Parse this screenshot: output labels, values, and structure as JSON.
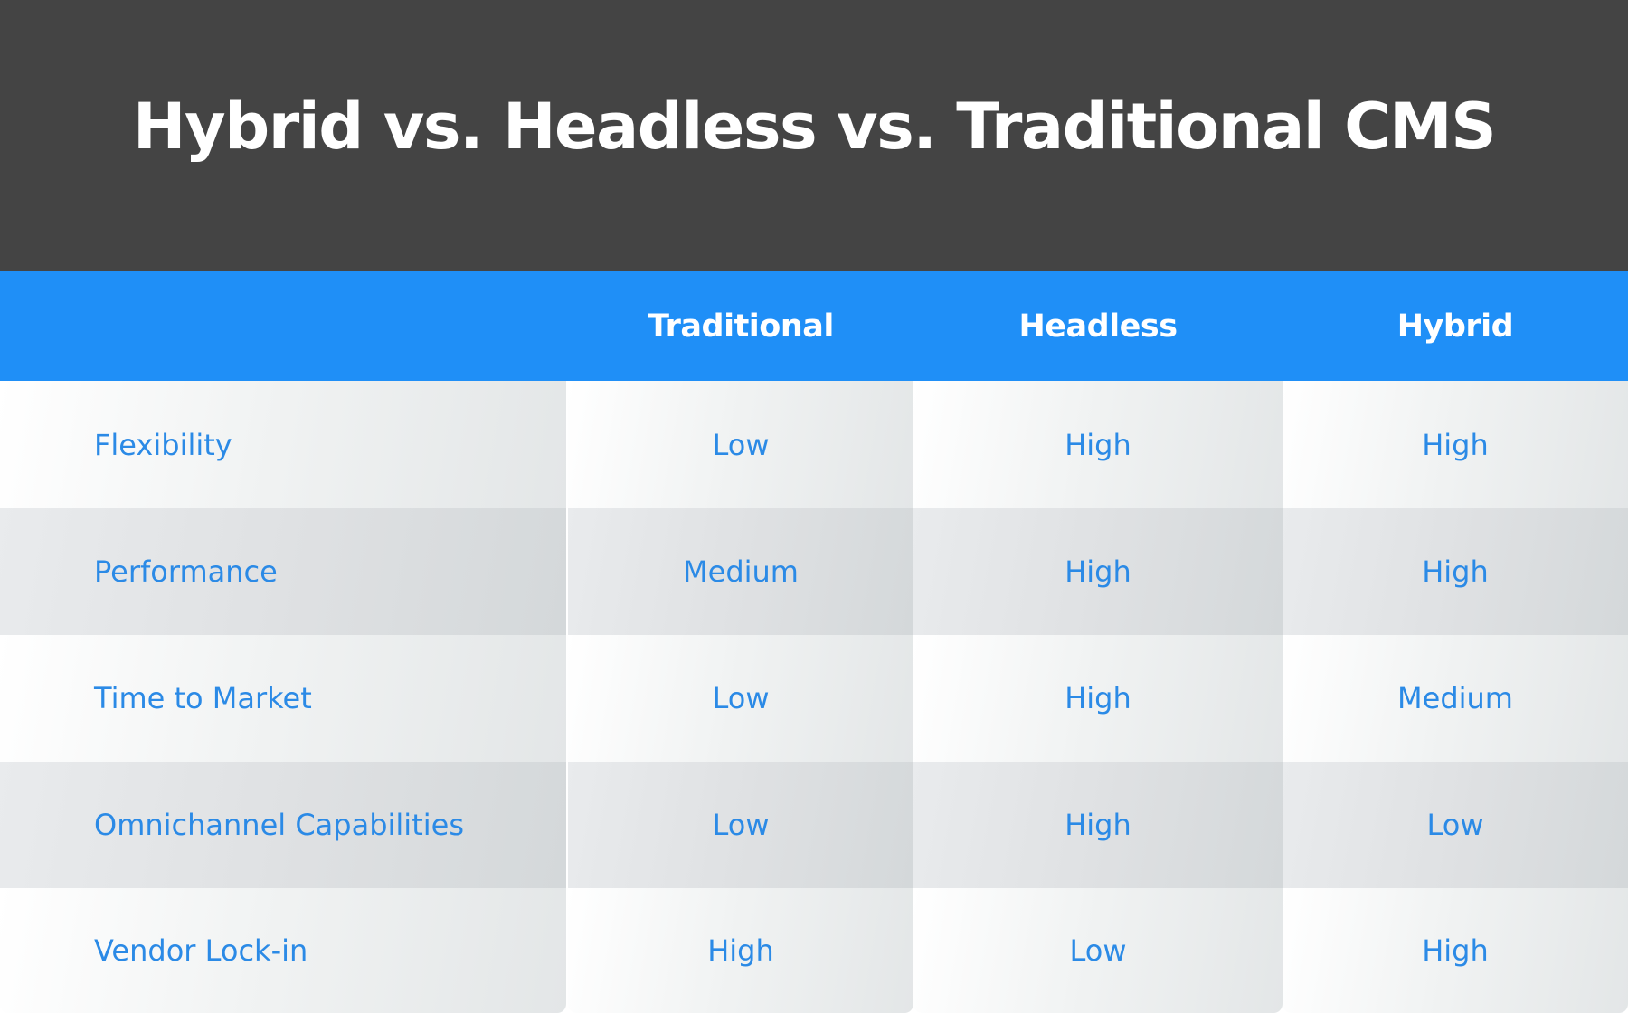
{
  "title": "Hybrid vs. Headless vs. Traditional CMS",
  "colors": {
    "title_background": "#444444",
    "header_background": "#1f8ff7",
    "accent_text": "#2b8ae6"
  },
  "table": {
    "columns": [
      "",
      "Traditional",
      "Headless",
      "Hybrid"
    ],
    "rows": [
      {
        "feature": "Flexibility",
        "traditional": "Low",
        "headless": "High",
        "hybrid": "High"
      },
      {
        "feature": "Performance",
        "traditional": "Medium",
        "headless": "High",
        "hybrid": "High"
      },
      {
        "feature": "Time to Market",
        "traditional": "Low",
        "headless": "High",
        "hybrid": "Medium"
      },
      {
        "feature": "Omnichannel Capabilities",
        "traditional": "Low",
        "headless": "High",
        "hybrid": "Low"
      },
      {
        "feature": "Vendor Lock-in",
        "traditional": "High",
        "headless": "Low",
        "hybrid": "High"
      }
    ]
  }
}
